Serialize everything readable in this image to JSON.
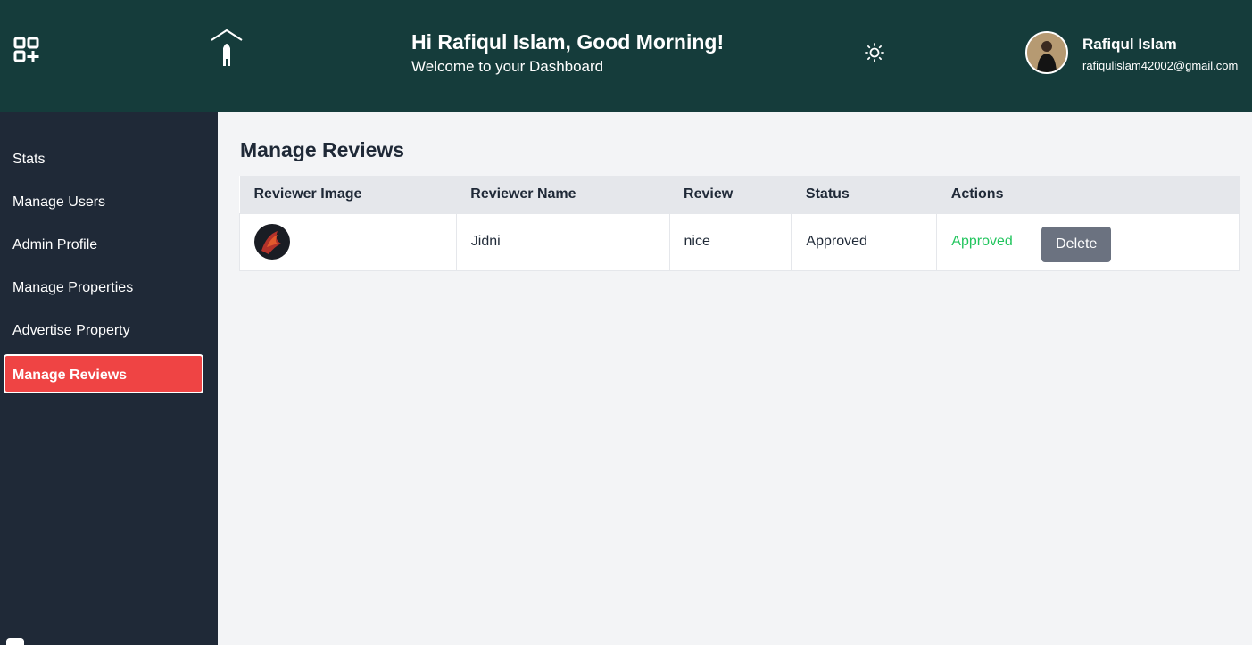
{
  "header": {
    "greeting_title": "Hi Rafiqul Islam, Good Morning!",
    "greeting_subtitle": "Welcome to your Dashboard",
    "user_name": "Rafiqul Islam",
    "user_email": "rafiqulislam42002@gmail.com",
    "menu_icon": "apps-add-icon",
    "logo_icon": "house-logo-icon",
    "theme_icon": "sun-icon"
  },
  "sidebar": {
    "items": [
      {
        "label": "Stats"
      },
      {
        "label": "Manage Users"
      },
      {
        "label": "Admin Profile"
      },
      {
        "label": "Manage Properties"
      },
      {
        "label": "Advertise Property"
      },
      {
        "label": "Manage Reviews",
        "active": true
      }
    ]
  },
  "main": {
    "title": "Manage Reviews",
    "table": {
      "columns": [
        "Reviewer Image",
        "Reviewer Name",
        "Review",
        "Status",
        "Actions"
      ],
      "rows": [
        {
          "name": "Jidni",
          "review": "nice",
          "status": "Approved",
          "action_status": "Approved",
          "delete_label": "Delete"
        }
      ]
    }
  },
  "colors": {
    "header_bg": "#153c3b",
    "sidebar_bg": "#1f2937",
    "active_item": "#ef4444",
    "approved": "#22c55e",
    "delete_button": "#6b7280"
  }
}
